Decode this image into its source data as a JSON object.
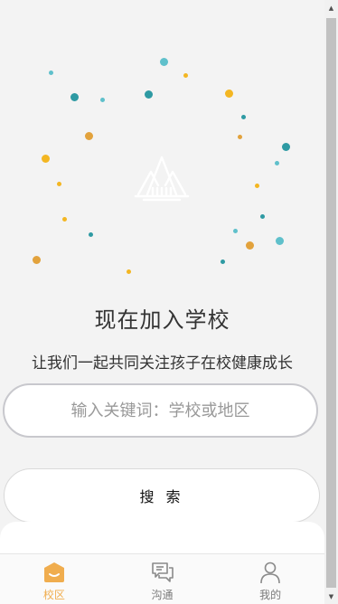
{
  "hero": {
    "title": "现在加入学校",
    "subtitle": "让我们一起共同关注孩子在校健康成长",
    "icon": "school-mountain-icon",
    "dot_colors": [
      "#48b6c4",
      "#f3b622",
      "#e2a23c",
      "#2e9aa3"
    ]
  },
  "search": {
    "placeholder": "输入关键词：学校或地区",
    "value": "",
    "button_label": "搜 索"
  },
  "tabbar": {
    "items": [
      {
        "label": "校区",
        "icon": "school-home-icon",
        "active": true
      },
      {
        "label": "沟通",
        "icon": "chat-icon",
        "active": false
      },
      {
        "label": "我的",
        "icon": "profile-icon",
        "active": false
      }
    ],
    "active_color": "#f0ad4e",
    "inactive_color": "#7a7a7a"
  },
  "scrollbar": {
    "up_arrow": "▲",
    "down_arrow": "▼"
  }
}
